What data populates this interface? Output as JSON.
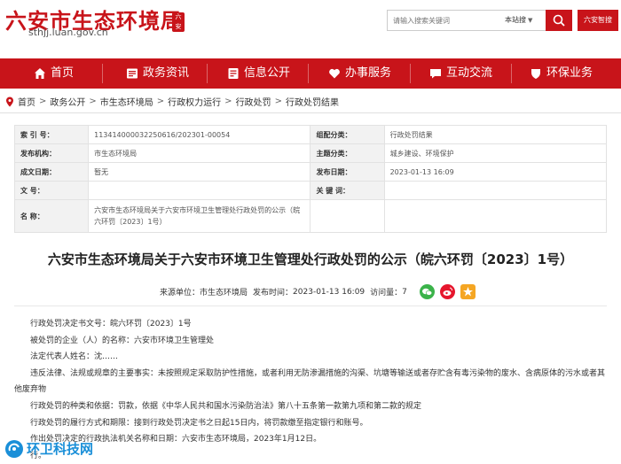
{
  "header": {
    "site_title": "六安市生态环境局",
    "seal_text": "六安",
    "domain": "sthjj.luan.gov.cn",
    "search_placeholder": "请输入搜索关键词",
    "search_scope": "本站搜",
    "wechat_button": "六安智搜"
  },
  "nav": {
    "items": [
      {
        "label": "首页",
        "icon": "home-icon"
      },
      {
        "label": "政务资讯",
        "icon": "news-icon"
      },
      {
        "label": "信息公开",
        "icon": "info-icon"
      },
      {
        "label": "办事服务",
        "icon": "service-icon"
      },
      {
        "label": "互动交流",
        "icon": "chat-icon"
      },
      {
        "label": "环保业务",
        "icon": "env-icon"
      }
    ]
  },
  "breadcrumb": [
    "首页",
    "政务公开",
    "市生态环境局",
    "行政权力运行",
    "行政处罚",
    "行政处罚结果"
  ],
  "info_table": {
    "index_label": "索  引  号：",
    "index_value": "113414000032250616/202301-00054",
    "category_label": "组配分类：",
    "category_value": "行政处罚结果",
    "publisher_label": "发布机构：",
    "publisher_value": "市生态环境局",
    "topic_label": "主题分类：",
    "topic_value": "城乡建设、环境保护",
    "created_label": "成文日期：",
    "created_value": "暂无",
    "published_label": "发布日期：",
    "published_value": "2023-01-13 16:09",
    "docno_label": "文      号：",
    "docno_value": "",
    "keywords_label": "关  键  词：",
    "keywords_value": "",
    "name_label": "名      称：",
    "name_value": "六安市生态环境局关于六安市环境卫生管理处行政处罚的公示（皖六环罚〔2023〕1号）"
  },
  "article": {
    "title": "六安市生态环境局关于六安市环境卫生管理处行政处罚的公示（皖六环罚〔2023〕1号）",
    "source_label": "来源单位：",
    "source_value": "市生态环境局",
    "date_label": "发布时间：",
    "date_value": "2023-01-13 16:09",
    "reads_label": "访问量：",
    "reads_value": "7",
    "paragraphs": [
      "行政处罚决定书文号：皖六环罚〔2023〕1号",
      "被处罚的企业（人）的名称：六安市环境卫生管理处",
      "法定代表人姓名：沈……",
      "违反法律、法规或规章的主要事实：未按照规定采取防护性措施，或者利用无防渗漏措施的沟渠、坑塘等输送或者存贮含有毒污染物的废水、含病原体的污水或者其他废弃物",
      "行政处罚的种类和依据：罚款，依据《中华人民共和国水污染防治法》第八十五条第一款第九项和第二款的规定",
      "行政处罚的履行方式和期限：接到行政处罚决定书之日起15日内，将罚款缴至指定银行和账号。",
      "作出处罚决定的行政执法机关名称和日期：六安市生态环境局，2023年1月12日。",
      "行。"
    ]
  },
  "watermark": "环卫科技网",
  "colors": {
    "brand_red": "#c8141a",
    "watermark_blue": "#1a8fd8"
  }
}
